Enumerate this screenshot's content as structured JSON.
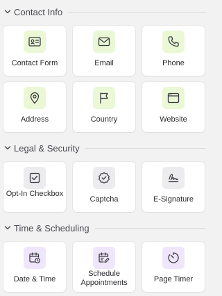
{
  "colors": {
    "contact_icon_bg": "#eaf8d6",
    "legal_icon_bg": "#ececef",
    "time_icon_bg": "#efe6fb",
    "card_bg": "#ffffff",
    "panel_bg": "#f2f2f3"
  },
  "sections": [
    {
      "title": "Contact Info",
      "items": [
        {
          "label": "Contact Form",
          "icon": "id-card-icon"
        },
        {
          "label": "Email",
          "icon": "envelope-icon"
        },
        {
          "label": "Phone",
          "icon": "phone-icon"
        },
        {
          "label": "Address",
          "icon": "map-pin-icon"
        },
        {
          "label": "Country",
          "icon": "flag-icon"
        },
        {
          "label": "Website",
          "icon": "browser-window-icon"
        }
      ]
    },
    {
      "title": "Legal & Security",
      "items": [
        {
          "label": "Opt-In Checkbox",
          "icon": "checkbox-icon"
        },
        {
          "label": "Captcha",
          "icon": "badge-check-icon"
        },
        {
          "label": "E-Signature",
          "icon": "signature-icon"
        }
      ]
    },
    {
      "title": "Time & Scheduling",
      "items": [
        {
          "label": "Date & Time",
          "icon": "calendar-clock-icon"
        },
        {
          "label": "Schedule Appointments",
          "icon": "calendar-edit-icon"
        },
        {
          "label": "Page Timer",
          "icon": "timer-icon"
        }
      ]
    }
  ]
}
